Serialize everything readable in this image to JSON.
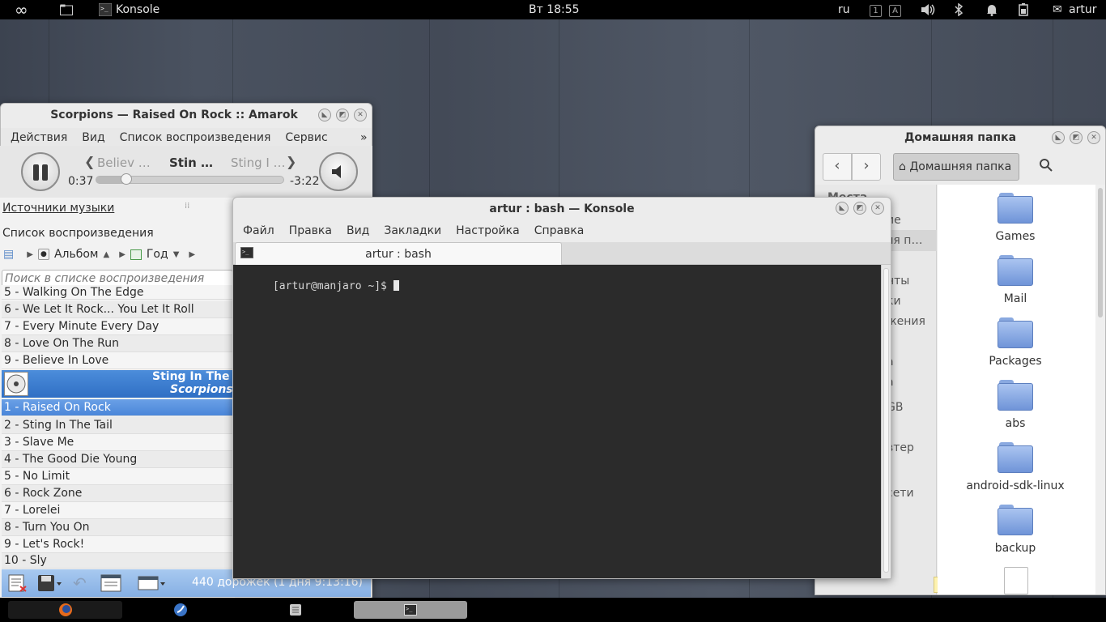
{
  "top_panel": {
    "activities_icon": "infinity-icon",
    "files_icon": "folder-icon",
    "app_name": "Konsole",
    "clock": "Вт 18:55",
    "layout": "ru",
    "kbd_indicators": [
      "1",
      "A"
    ],
    "user": "artur"
  },
  "amarok": {
    "title": "Scorpions — Raised On Rock  ::  Amarok",
    "menu": [
      "Действия",
      "Вид",
      "Список воспроизведения",
      "Сервис"
    ],
    "prev_track": "Believ …",
    "current_track": "Stin …",
    "next_track": "Sting I …",
    "elapsed": "0:37",
    "remaining": "-3:22",
    "progress_fraction": 0.16,
    "sources_label": "Источники музыки",
    "playlist_label": "Список воспроизведения",
    "sort_album": "Альбом",
    "sort_year": "Год",
    "search_placeholder": "Поиск в списке воспроизведения",
    "tracks_top": [
      "5 - Walking On The Edge",
      "6 - We Let It Rock... You Let It Roll",
      "7 - Every Minute Every Day",
      "8 - Love On The Run",
      "9 - Believe In Love"
    ],
    "album_title": "Sting In The T",
    "album_artist": "Scorpions",
    "tracks_bottom": [
      "1 - Raised On Rock",
      "2 - Sting In The Tail",
      "3 - Slave Me",
      "4 - The Good Die Young",
      "5 - No Limit",
      "6 - Rock Zone",
      "7 - Lorelei",
      "8 - Turn You On",
      "9 - Let's Rock!",
      "10 - Sly"
    ],
    "footer_status": "440 дорожек (1 дня 9:13:16)"
  },
  "konsole": {
    "title": "artur : bash — Konsole",
    "menu": [
      "Файл",
      "Правка",
      "Вид",
      "Закладки",
      "Настройка",
      "Справка"
    ],
    "tab_label": "artur : bash",
    "prompt": "[artur@manjaro ~]$ "
  },
  "files": {
    "title": "Домашняя папка",
    "path_button": "Домашняя папка",
    "places_partial": [
      "Места",
      "ие",
      "яя п…",
      "нты",
      "ки",
      "жения",
      "а",
      "а",
      "GB",
      "втер",
      "сети"
    ],
    "folders": [
      "Games",
      "Mail",
      "Packages",
      "abs",
      "android-sdk-linux",
      "backup"
    ]
  },
  "taskbar": {
    "items": [
      "firefox-icon",
      "amarok-icon",
      "files-icon",
      "konsole-icon"
    ]
  }
}
